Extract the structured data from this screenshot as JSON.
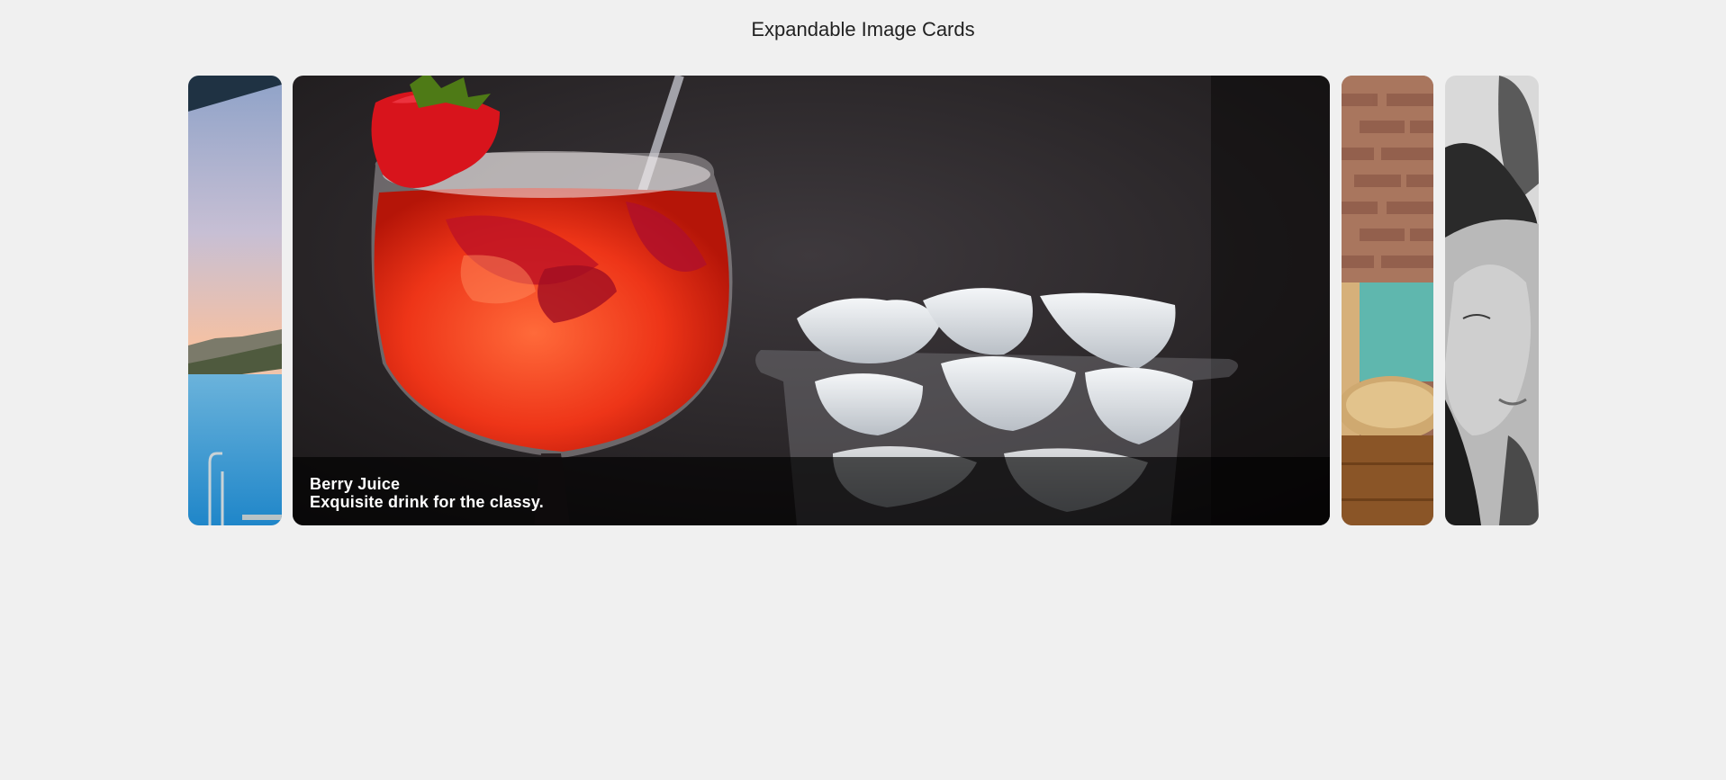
{
  "page": {
    "title": "Expandable Image Cards"
  },
  "cards": [
    {
      "title": "",
      "subtitle": "",
      "expanded": false,
      "image": "pool-sunset-image"
    },
    {
      "title": "Berry Juice",
      "subtitle": "Exquisite drink for the classy.",
      "expanded": true,
      "image": "berry-juice-image"
    },
    {
      "title": "",
      "subtitle": "",
      "expanded": false,
      "image": "cafe-table-image"
    },
    {
      "title": "",
      "subtitle": "",
      "expanded": false,
      "image": "couple-bw-image"
    }
  ]
}
